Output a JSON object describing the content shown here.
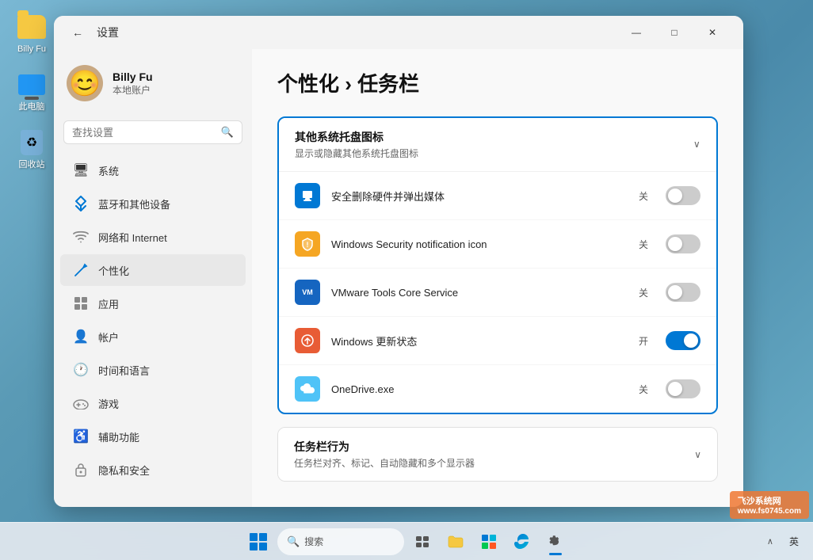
{
  "desktop": {
    "icons": [
      {
        "label": "Billy Fu",
        "type": "folder"
      },
      {
        "label": "此电脑",
        "type": "computer"
      },
      {
        "label": "回收站",
        "type": "recycle"
      }
    ]
  },
  "taskbar": {
    "search_placeholder": "搜索",
    "language": "英",
    "tray_arrow": "∧"
  },
  "window": {
    "back_button": "←",
    "title": "设置",
    "controls": {
      "minimize": "—",
      "maximize": "□",
      "close": "✕"
    }
  },
  "user": {
    "name": "Billy Fu",
    "account_type": "本地账户",
    "avatar": "😊"
  },
  "search": {
    "placeholder": "查找设置"
  },
  "nav_items": [
    {
      "id": "system",
      "icon": "🖥",
      "label": "系统"
    },
    {
      "id": "bluetooth",
      "icon": "⚡",
      "label": "蓝牙和其他设备"
    },
    {
      "id": "network",
      "icon": "📶",
      "label": "网络和 Internet"
    },
    {
      "id": "personalization",
      "icon": "✏️",
      "label": "个性化",
      "active": true
    },
    {
      "id": "apps",
      "icon": "📦",
      "label": "应用"
    },
    {
      "id": "accounts",
      "icon": "👤",
      "label": "帐户"
    },
    {
      "id": "time",
      "icon": "🕐",
      "label": "时间和语言"
    },
    {
      "id": "gaming",
      "icon": "🎮",
      "label": "游戏"
    },
    {
      "id": "accessibility",
      "icon": "♿",
      "label": "辅助功能"
    },
    {
      "id": "privacy",
      "icon": "🔒",
      "label": "隐私和安全"
    }
  ],
  "page": {
    "breadcrumb": "个性化 › 任务栏"
  },
  "section_systray": {
    "title": "其他系统托盘图标",
    "subtitle": "显示或隐藏其他系统托盘图标",
    "expanded": true,
    "chevron": "∧",
    "items": [
      {
        "id": "safe-remove",
        "label": "安全删除硬件并弹出媒体",
        "icon": "💾",
        "icon_color": "blue",
        "status": "关",
        "on": false
      },
      {
        "id": "windows-security",
        "label": "Windows Security notification icon",
        "icon": "⚠",
        "icon_color": "yellow",
        "status": "关",
        "on": false
      },
      {
        "id": "vmware",
        "label": "VMware Tools Core Service",
        "icon": "VM",
        "icon_color": "gray",
        "status": "关",
        "on": false
      },
      {
        "id": "windows-update",
        "label": "Windows 更新状态",
        "icon": "🔄",
        "icon_color": "red",
        "status": "开",
        "on": true
      },
      {
        "id": "onedrive",
        "label": "OneDrive.exe",
        "icon": "☁",
        "icon_color": "lightblue",
        "status": "关",
        "on": false
      }
    ]
  },
  "section_taskbar_behavior": {
    "title": "任务栏行为",
    "subtitle": "任务栏对齐、标记、自动隐藏和多个显示器",
    "expanded": false,
    "chevron": "∨"
  },
  "watermark": {
    "text": "飞沙系统网",
    "url": "www.fs0745.com"
  }
}
